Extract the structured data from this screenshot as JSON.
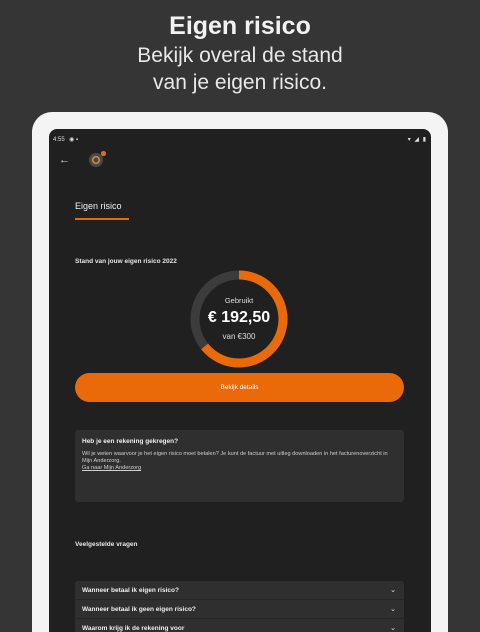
{
  "promo": {
    "title": "Eigen risico",
    "subtitle_line1": "Bekijk overal de stand",
    "subtitle_line2": "van je eigen risico."
  },
  "statusbar": {
    "time": "4:55"
  },
  "header": {
    "tab_label": "Eigen risico"
  },
  "standing": {
    "label": "Stand van jouw eigen risico 2022",
    "used_label": "Gebruikt",
    "used_amount": "€ 192,50",
    "total_label": "van €300",
    "fraction_used": 0.6417
  },
  "cta": {
    "label": "Bekijk details"
  },
  "info": {
    "question": "Heb je een rekening gekregen?",
    "body": "Wil je weten waarvoor je het eigen risico moet betalen? Je kunt de factuur met uitleg downloaden in het facturenoverzicht in Mijn Anderzorg.",
    "link": "Ga naar Mijn Anderzorg"
  },
  "faq": {
    "heading": "Veelgestelde vragen",
    "items": [
      {
        "label": "Wanneer betaal ik eigen risico?"
      },
      {
        "label": "Wanneer betaal ik geen eigen risico?"
      },
      {
        "label": "Waarom krijg ik de rekening voor"
      }
    ]
  },
  "colors": {
    "accent": "#ea6a0a",
    "background": "#202020",
    "card": "#2f2f2f"
  }
}
